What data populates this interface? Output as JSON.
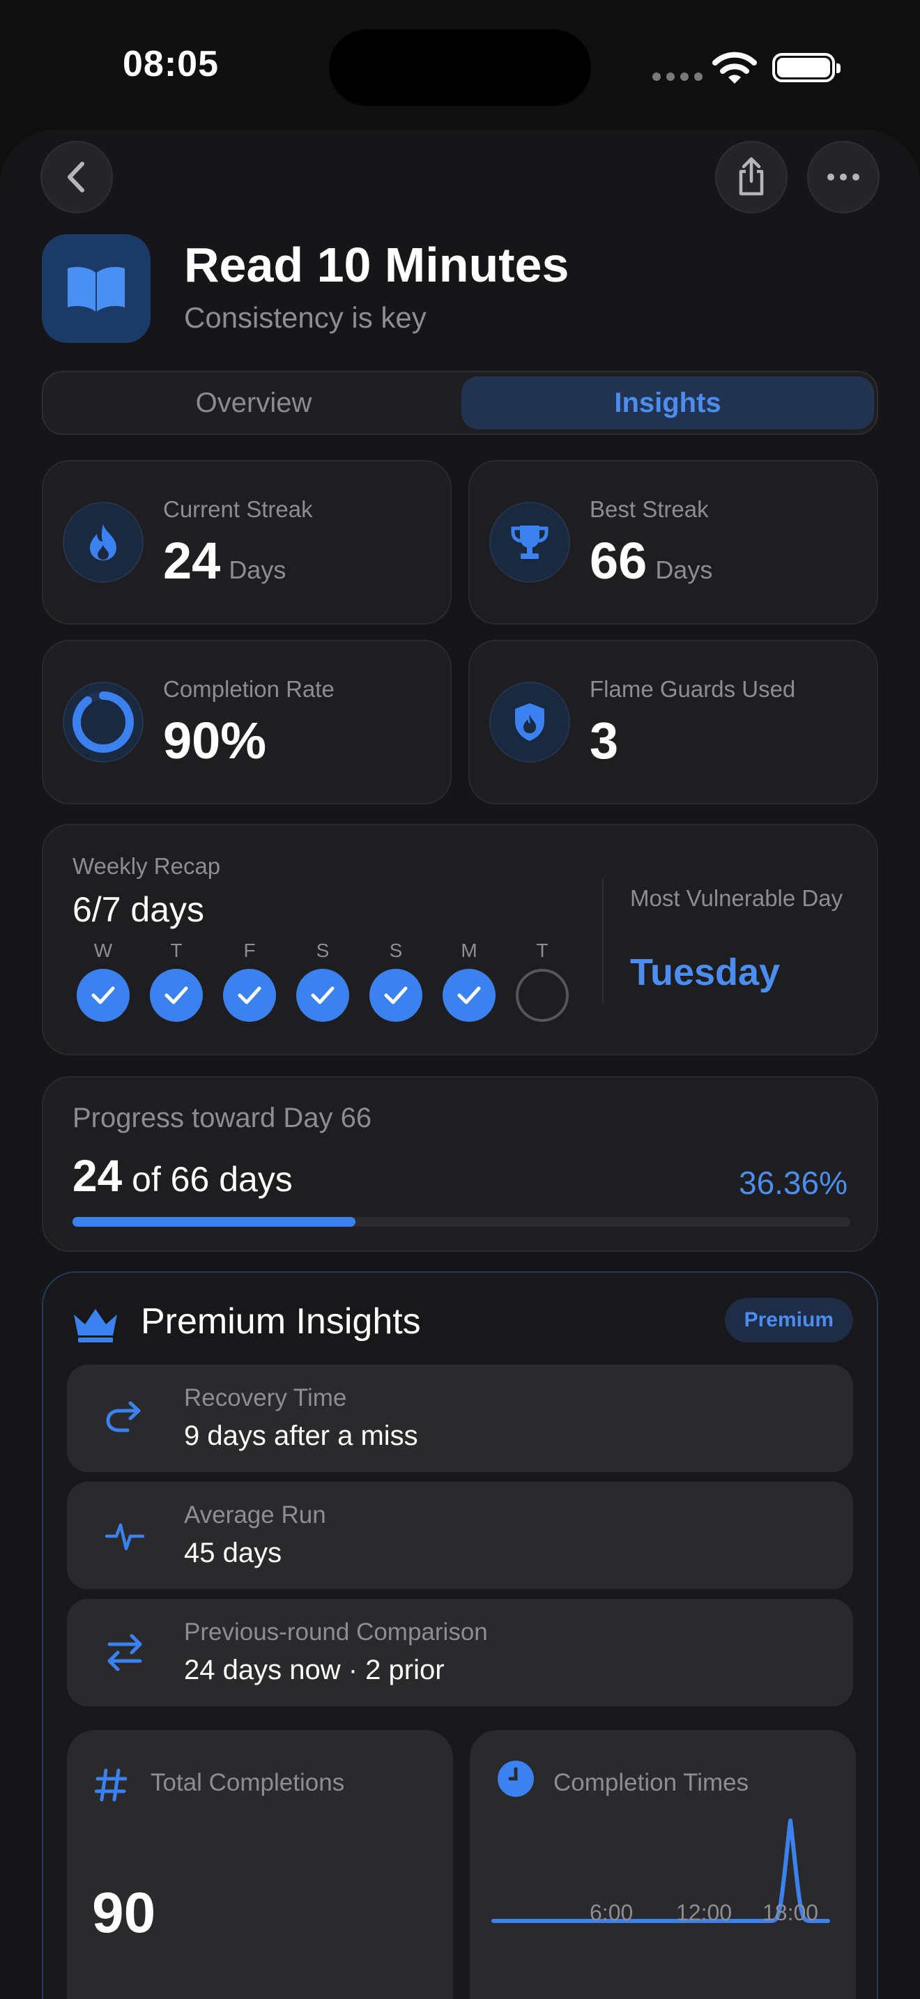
{
  "status": {
    "time": "08:05"
  },
  "habit": {
    "title": "Read 10 Minutes",
    "subtitle": "Consistency is key"
  },
  "tabs": [
    {
      "label": "Overview",
      "selected": false
    },
    {
      "label": "Insights",
      "selected": true
    }
  ],
  "stats": {
    "current_streak": {
      "label": "Current Streak",
      "value": "24",
      "unit": "Days"
    },
    "best_streak": {
      "label": "Best Streak",
      "value": "66",
      "unit": "Days"
    },
    "completion_rate": {
      "label": "Completion Rate",
      "value": "90%",
      "fraction": 0.9
    },
    "flame_guards": {
      "label": "Flame Guards Used",
      "value": "3"
    }
  },
  "weekly_recap": {
    "label": "Weekly Recap",
    "value": "6/7 days",
    "days": [
      {
        "letter": "W",
        "done": true
      },
      {
        "letter": "T",
        "done": true
      },
      {
        "letter": "F",
        "done": true
      },
      {
        "letter": "S",
        "done": true
      },
      {
        "letter": "S",
        "done": true
      },
      {
        "letter": "M",
        "done": true
      },
      {
        "letter": "T",
        "done": false
      }
    ],
    "vulnerable_label": "Most Vulnerable Day",
    "vulnerable_value": "Tuesday"
  },
  "progress": {
    "label": "Progress toward Day 66",
    "current": "24",
    "rest": "of 66 days",
    "percent_text": "36.36%",
    "fraction": 0.3636
  },
  "premium": {
    "title": "Premium Insights",
    "badge": "Premium",
    "rows": [
      {
        "label": "Recovery Time",
        "value": "9 days after a miss",
        "icon": "redo-arrow-icon"
      },
      {
        "label": "Average Run",
        "value": "45 days",
        "icon": "pulse-icon"
      },
      {
        "label": "Previous-round Comparison",
        "value": "24 days now · 2 prior",
        "icon": "swap-arrows-icon"
      }
    ],
    "total": {
      "label": "Total Completions",
      "value": "90"
    },
    "times": {
      "label": "Completion Times",
      "ticks": [
        "6:00",
        "12:00",
        "18:00"
      ]
    }
  },
  "colors": {
    "accent": "#3b82f0",
    "background": "#0f0f10",
    "card": "#1e1e20"
  }
}
